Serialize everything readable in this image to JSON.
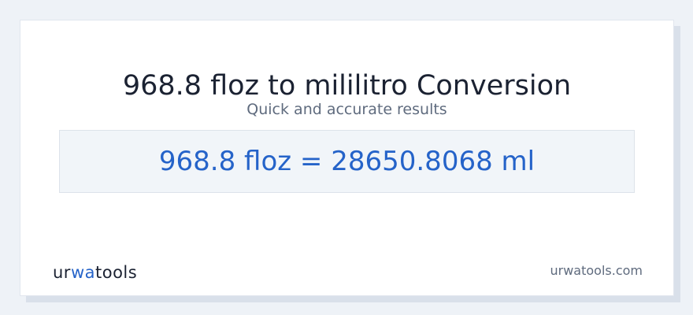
{
  "card": {
    "title": "968.8 floz to mililitro Conversion",
    "subtitle": "Quick and accurate results",
    "result": "968.8 floz = 28650.8068 ml"
  },
  "footer": {
    "logo_part1": "ur",
    "logo_accent": "wa",
    "logo_part2": "tools",
    "site": "urwatools.com"
  },
  "colors": {
    "accent": "#2563c9",
    "title": "#1b2232",
    "muted": "#5f6b7e",
    "result_bg": "#f1f5f9"
  }
}
